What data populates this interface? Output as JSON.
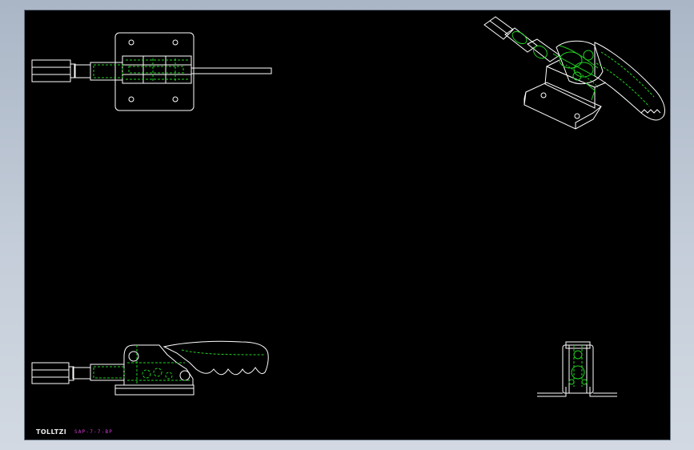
{
  "drawing": {
    "logo_text": "TOLLTZI",
    "part_number": "SAP-7-7-BP"
  },
  "views": [
    "top-view",
    "isometric-view",
    "front-view",
    "side-view"
  ],
  "colors": {
    "background": "#000000",
    "outline": "#ffffff",
    "hidden_lines": "#1fd21f",
    "annotation": "#d33bd3"
  }
}
